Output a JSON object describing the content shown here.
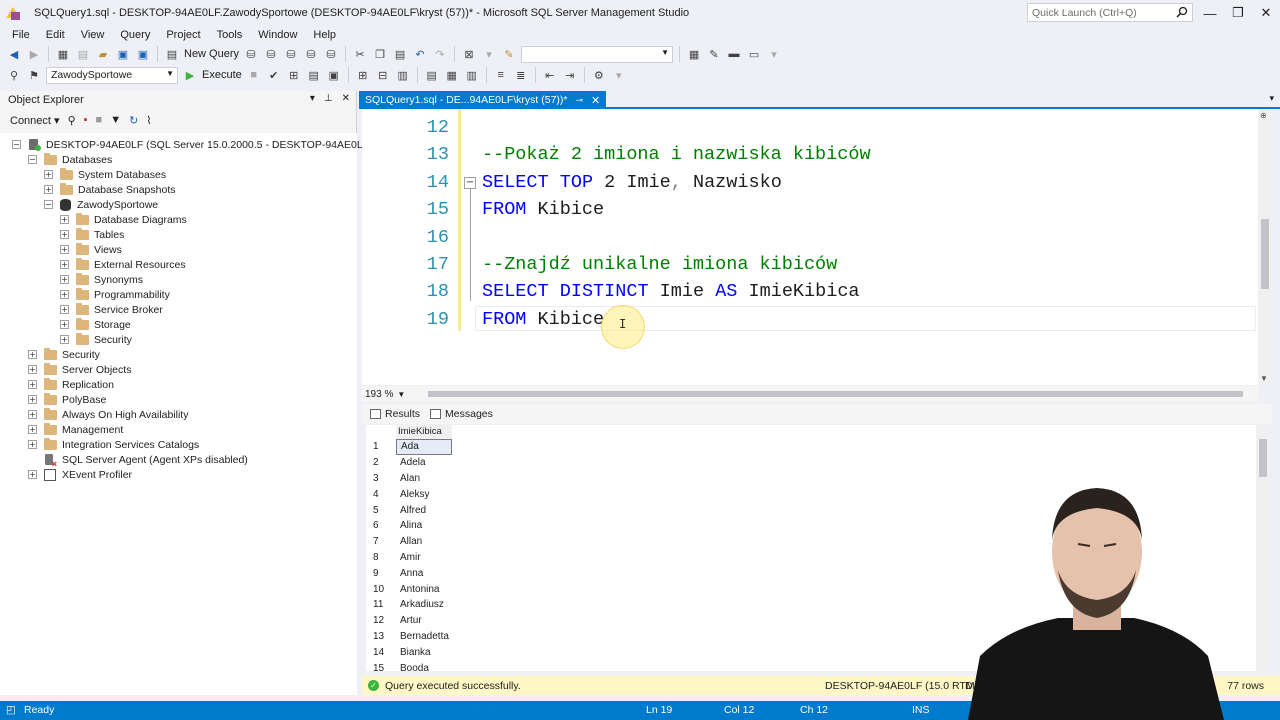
{
  "window": {
    "title": "SQLQuery1.sql - DESKTOP-94AE0LF.ZawodySportowe (DESKTOP-94AE0LF\\kryst (57))* - Microsoft SQL Server Management Studio",
    "quick_launch_placeholder": "Quick Launch (Ctrl+Q)"
  },
  "menu": [
    "File",
    "Edit",
    "View",
    "Query",
    "Project",
    "Tools",
    "Window",
    "Help"
  ],
  "toolbar": {
    "new_query_label": "New Query",
    "database_combo": "ZawodySportowe",
    "execute_label": "Execute"
  },
  "object_explorer": {
    "title": "Object Explorer",
    "connect_label": "Connect",
    "nodes": [
      {
        "label": "DESKTOP-94AE0LF (SQL Server 15.0.2000.5 - DESKTOP-94AE0LF\\kryst)",
        "level": 0,
        "expander": "−",
        "icon": "server-icon"
      },
      {
        "label": "Databases",
        "level": 1,
        "expander": "−",
        "icon": "folder-icon"
      },
      {
        "label": "System Databases",
        "level": 2,
        "expander": "+",
        "icon": "folder-icon"
      },
      {
        "label": "Database Snapshots",
        "level": 2,
        "expander": "+",
        "icon": "folder-icon"
      },
      {
        "label": "ZawodySportowe",
        "level": 2,
        "expander": "−",
        "icon": "database-icon"
      },
      {
        "label": "Database Diagrams",
        "level": 3,
        "expander": "+",
        "icon": "folder-icon"
      },
      {
        "label": "Tables",
        "level": 3,
        "expander": "+",
        "icon": "folder-icon"
      },
      {
        "label": "Views",
        "level": 3,
        "expander": "+",
        "icon": "folder-icon"
      },
      {
        "label": "External Resources",
        "level": 3,
        "expander": "+",
        "icon": "folder-icon"
      },
      {
        "label": "Synonyms",
        "level": 3,
        "expander": "+",
        "icon": "folder-icon"
      },
      {
        "label": "Programmability",
        "level": 3,
        "expander": "+",
        "icon": "folder-icon"
      },
      {
        "label": "Service Broker",
        "level": 3,
        "expander": "+",
        "icon": "folder-icon"
      },
      {
        "label": "Storage",
        "level": 3,
        "expander": "+",
        "icon": "folder-icon"
      },
      {
        "label": "Security",
        "level": 3,
        "expander": "+",
        "icon": "folder-icon"
      },
      {
        "label": "Security",
        "level": 1,
        "expander": "+",
        "icon": "folder-icon"
      },
      {
        "label": "Server Objects",
        "level": 1,
        "expander": "+",
        "icon": "folder-icon"
      },
      {
        "label": "Replication",
        "level": 1,
        "expander": "+",
        "icon": "folder-icon"
      },
      {
        "label": "PolyBase",
        "level": 1,
        "expander": "+",
        "icon": "folder-icon"
      },
      {
        "label": "Always On High Availability",
        "level": 1,
        "expander": "+",
        "icon": "folder-icon"
      },
      {
        "label": "Management",
        "level": 1,
        "expander": "+",
        "icon": "folder-icon"
      },
      {
        "label": "Integration Services Catalogs",
        "level": 1,
        "expander": "+",
        "icon": "folder-icon"
      },
      {
        "label": "SQL Server Agent (Agent XPs disabled)",
        "level": 1,
        "expander": "",
        "icon": "agent-icon"
      },
      {
        "label": "XEvent Profiler",
        "level": 1,
        "expander": "+",
        "icon": "xevent-icon"
      }
    ]
  },
  "editor": {
    "tab_label": "SQLQuery1.sql - DE...94AE0LF\\kryst (57))*",
    "zoom": "193 %",
    "lines": [
      {
        "num": "12",
        "tokens": []
      },
      {
        "num": "13",
        "tokens": [
          {
            "t": "--Pokaż 2 imiona i nazwiska kibiców",
            "c": "cm"
          }
        ]
      },
      {
        "num": "14",
        "tokens": [
          {
            "t": "SELECT",
            "c": "kw"
          },
          {
            "t": " ",
            "c": "tx"
          },
          {
            "t": "TOP",
            "c": "kw"
          },
          {
            "t": " 2 Imie",
            "c": "tx"
          },
          {
            "t": ",",
            "c": "op"
          },
          {
            "t": " Nazwisko",
            "c": "tx"
          }
        ]
      },
      {
        "num": "15",
        "tokens": [
          {
            "t": "FROM",
            "c": "kw"
          },
          {
            "t": " Kibice",
            "c": "tx"
          }
        ]
      },
      {
        "num": "16",
        "tokens": []
      },
      {
        "num": "17",
        "tokens": [
          {
            "t": "--Znajdź unikalne imiona kibiców",
            "c": "cm"
          }
        ]
      },
      {
        "num": "18",
        "tokens": [
          {
            "t": "SELECT",
            "c": "kw"
          },
          {
            "t": " ",
            "c": "tx"
          },
          {
            "t": "DISTINCT",
            "c": "kw"
          },
          {
            "t": " Imie ",
            "c": "tx"
          },
          {
            "t": "AS",
            "c": "kw"
          },
          {
            "t": " ImieKibica",
            "c": "tx"
          }
        ]
      },
      {
        "num": "19",
        "tokens": [
          {
            "t": "FROM",
            "c": "kw"
          },
          {
            "t": " Kibice",
            "c": "tx"
          }
        ]
      }
    ]
  },
  "results": {
    "tab_results": "Results",
    "tab_messages": "Messages",
    "column": "ImieKibica",
    "rows": [
      {
        "n": "1",
        "v": "Ada"
      },
      {
        "n": "2",
        "v": "Adela"
      },
      {
        "n": "3",
        "v": "Alan"
      },
      {
        "n": "4",
        "v": "Aleksy"
      },
      {
        "n": "5",
        "v": "Alfred"
      },
      {
        "n": "6",
        "v": "Alina"
      },
      {
        "n": "7",
        "v": "Allan"
      },
      {
        "n": "8",
        "v": "Amir"
      },
      {
        "n": "9",
        "v": "Anna"
      },
      {
        "n": "10",
        "v": "Antonina"
      },
      {
        "n": "11",
        "v": "Arkadiusz"
      },
      {
        "n": "12",
        "v": "Artur"
      },
      {
        "n": "13",
        "v": "Bernadetta"
      },
      {
        "n": "14",
        "v": "Bianka"
      },
      {
        "n": "15",
        "v": "Booda"
      }
    ]
  },
  "query_status": {
    "message": "Query executed successfully.",
    "server": "DESKTOP-94AE0LF (15.0 RTM)",
    "db_fragment": "D",
    "rows": "77 rows"
  },
  "statusbar": {
    "ready": "Ready",
    "ln": "Ln 19",
    "col": "Col 12",
    "ch": "Ch 12",
    "ins": "INS"
  },
  "colors": {
    "accent": "#007acc",
    "keyword": "#0000ff",
    "comment": "#008000",
    "line_number": "#2b91af",
    "status_ok_bg": "#fff8c6"
  }
}
